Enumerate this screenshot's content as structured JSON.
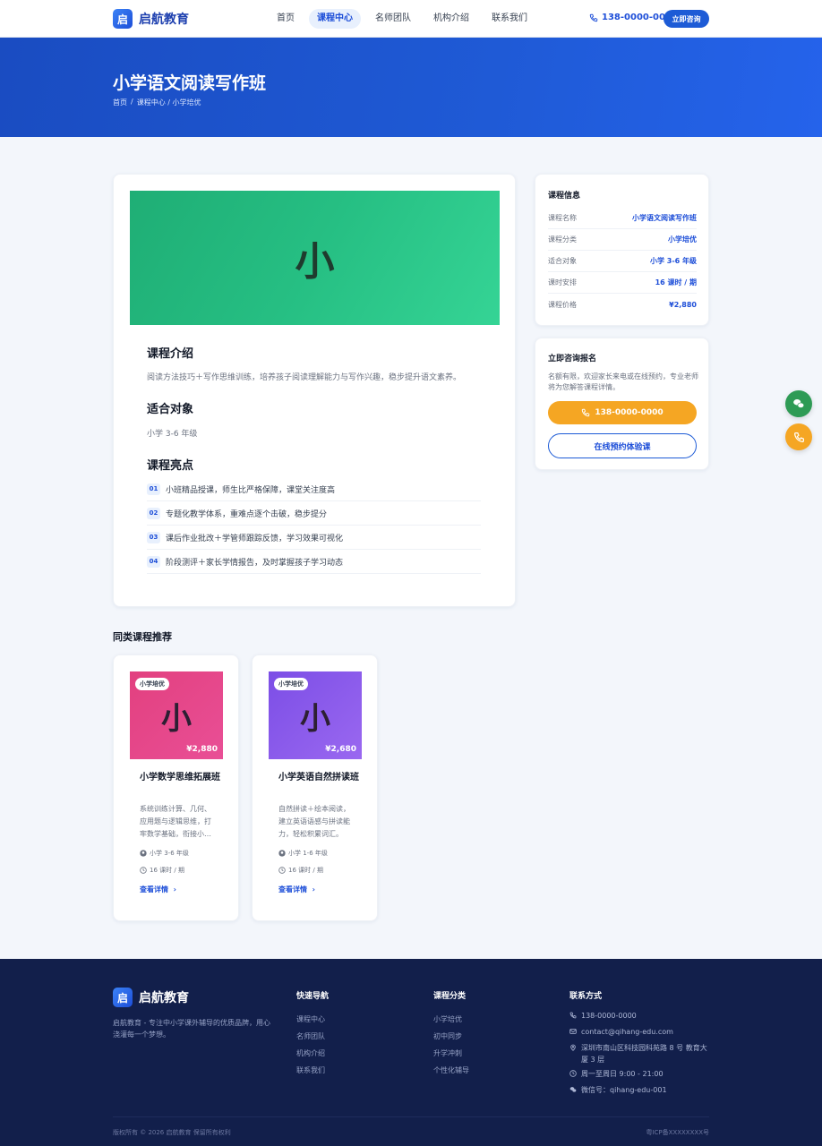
{
  "header": {
    "logo_char": "启",
    "logo_text": "启航教育",
    "nav": [
      "首页",
      "课程中心",
      "名师团队",
      "机构介绍",
      "联系我们"
    ],
    "active_nav": "课程中心",
    "phone": "138-0000-0000",
    "cta": "立即咨询"
  },
  "hero": {
    "title": "小学语文阅读写作班",
    "breadcrumb": [
      "首页",
      "/",
      "课程中心 / 小学培优"
    ]
  },
  "course": {
    "cover_char": "小",
    "intro_title": "课程介绍",
    "intro_text": "阅读方法技巧＋写作思维训练，培养孩子阅读理解能力与写作兴趣，稳步提升语文素养。",
    "target_title": "适合对象",
    "target_text": "小学 3-6 年级",
    "highlights_title": "课程亮点",
    "highlights": [
      {
        "num": "01",
        "text": "小班精品授课，师生比严格保障，课堂关注度高"
      },
      {
        "num": "02",
        "text": "专题化教学体系，重难点逐个击破，稳步提分"
      },
      {
        "num": "03",
        "text": "课后作业批改＋学管师跟踪反馈，学习效果可视化"
      },
      {
        "num": "04",
        "text": "阶段测评＋家长学情报告，及时掌握孩子学习动态"
      }
    ]
  },
  "info": {
    "title": "课程信息",
    "rows": [
      {
        "label": "课程名称",
        "value": "小学语文阅读写作班"
      },
      {
        "label": "课程分类",
        "value": "小学培优"
      },
      {
        "label": "适合对象",
        "value": "小学 3-6 年级"
      },
      {
        "label": "课时安排",
        "value": "16 课时 / 期"
      },
      {
        "label": "课程价格",
        "value": "¥2,880"
      }
    ]
  },
  "consult": {
    "title": "立即咨询报名",
    "text": "名额有限，欢迎家长来电或在线预约，专业老师将为您解答课程详情。",
    "phone_button": "138-0000-0000",
    "trial_button": "在线预约体验课"
  },
  "related": {
    "title": "同类课程推荐",
    "items": [
      {
        "tag": "小学培优",
        "char": "小",
        "price": "¥2,880",
        "name": "小学数学思维拓展班",
        "desc": "系统训练计算、几何、应用题与逻辑思维，打牢数学基础，衔接小…",
        "grade": "小学 3-6 年级",
        "hours": "16 课时 / 期",
        "link": "查看详情",
        "color_from": "#e2407f",
        "color_to": "#e94f96"
      },
      {
        "tag": "小学培优",
        "char": "小",
        "price": "¥2,680",
        "name": "小学英语自然拼读班",
        "desc": "自然拼读＋绘本阅读，建立英语语感与拼读能力，轻松积累词汇。",
        "grade": "小学 1-6 年级",
        "hours": "16 课时 / 期",
        "link": "查看详情",
        "color_from": "#7c4ee6",
        "color_to": "#9a68f0"
      }
    ]
  },
  "footer": {
    "logo_char": "启",
    "logo_text": "启航教育",
    "desc": "启航教育 - 专注中小学课外辅导的优质品牌，用心浇灌每一个梦想。",
    "nav_title": "快速导航",
    "nav_links": [
      "课程中心",
      "名师团队",
      "机构介绍",
      "联系我们"
    ],
    "cat_title": "课程分类",
    "cat_links": [
      "小学培优",
      "初中同步",
      "升学冲刺",
      "个性化辅导"
    ],
    "contact_title": "联系方式",
    "contacts": [
      {
        "icon": "phone-icon",
        "text": "138-0000-0000"
      },
      {
        "icon": "mail-icon",
        "text": "contact@qihang-edu.com"
      },
      {
        "icon": "location-icon",
        "text": "深圳市南山区科技园科苑路 8 号 教育大厦 3 层"
      },
      {
        "icon": "clock-icon",
        "text": "周一至周日 9:00 - 21:00"
      },
      {
        "icon": "wechat-icon",
        "text": "微信号：qihang-edu-001"
      }
    ],
    "copyright": "版权所有 © 2026 启航教育 保留所有权利",
    "icp": "粤ICP备XXXXXXXX号"
  },
  "colors": {
    "brand": "#1d5bd6",
    "accent": "#f5a623",
    "cover": "#26bf83",
    "footer_bg": "#121f4b"
  }
}
